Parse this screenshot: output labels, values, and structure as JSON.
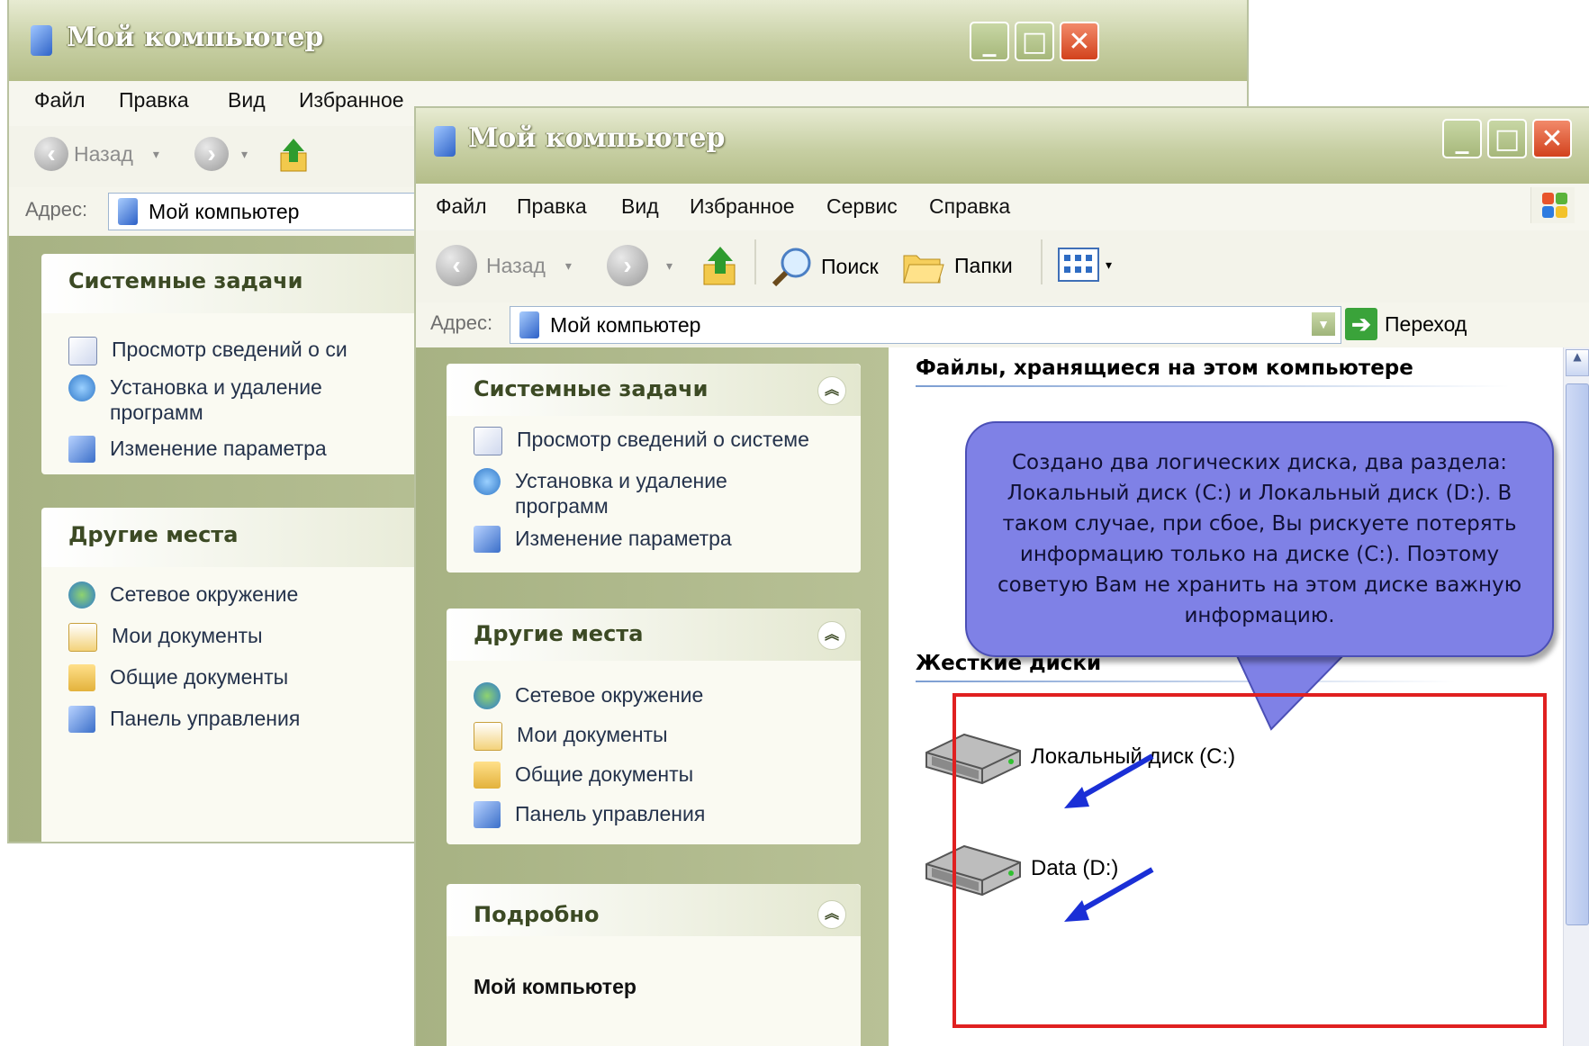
{
  "window": {
    "title": "Мой компьютер",
    "controls": {
      "minimize": "_",
      "maximize": "□",
      "close": "✕"
    }
  },
  "menu": [
    "Файл",
    "Правка",
    "Вид",
    "Избранное",
    "Сервис",
    "Справка"
  ],
  "toolbar": {
    "back": "Назад",
    "search": "Поиск",
    "folders": "Папки"
  },
  "address": {
    "label": "Адрес:",
    "value": "Мой компьютер",
    "go": "Переход"
  },
  "sidebar": {
    "system_tasks": {
      "title": "Системные задачи",
      "items": [
        {
          "label": "Просмотр сведений о системе",
          "short": "Просмотр сведений о си",
          "icon": "system-info-icon"
        },
        {
          "label": "Установка и удаление\nпрограмм",
          "icon": "add-remove-programs-icon"
        },
        {
          "label": "Изменение параметра",
          "icon": "change-setting-icon"
        }
      ]
    },
    "other_places": {
      "title": "Другие места",
      "items": [
        {
          "label": "Сетевое окружение",
          "icon": "network-icon"
        },
        {
          "label": "Мои документы",
          "icon": "my-documents-icon"
        },
        {
          "label": "Общие документы",
          "icon": "shared-documents-icon"
        },
        {
          "label": "Панель управления",
          "icon": "control-panel-icon"
        }
      ]
    },
    "details": {
      "title": "Подробно",
      "subtitle": "Мой компьютер"
    }
  },
  "content": {
    "stored_files_header": "Файлы, хранящиеся на этом компьютере",
    "hard_disks_header": "Жесткие диски",
    "drives": [
      {
        "label": "Локальный диск (C:)",
        "icon": "hard-drive-icon"
      },
      {
        "label": "Data (D:)",
        "icon": "hard-drive-icon"
      }
    ]
  },
  "annotation": {
    "callout_text": "Создано два логических диска, два раздела: Локальный диск (С:) и Локальный диск (D:). В таком случае, при сбое, Вы рискуете потерять информацию только на диске (С:). Поэтому советую Вам не хранить на этом диске важную информацию.",
    "highlight_color": "#e02020",
    "arrow_color": "#1a2fd6",
    "callout_color": "#7f81e6"
  }
}
